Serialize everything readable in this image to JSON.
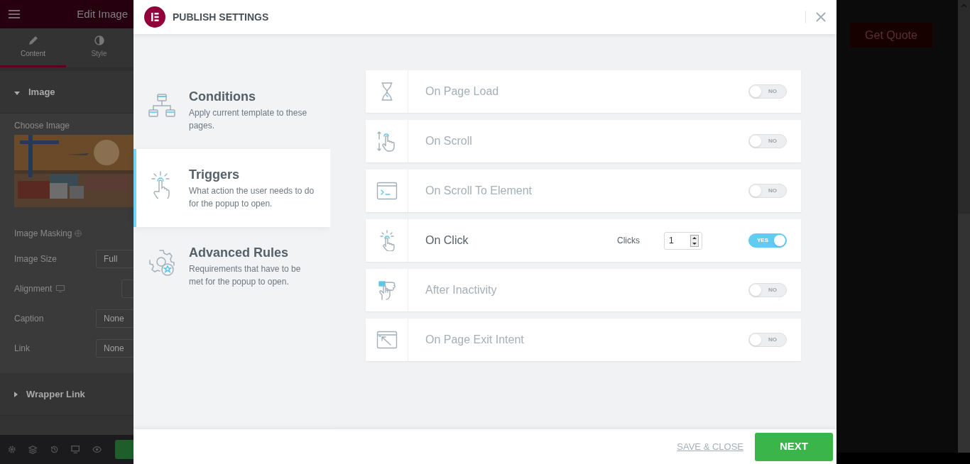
{
  "editor": {
    "title": "Edit Image",
    "tabs": [
      {
        "label": "Content",
        "selected": true
      },
      {
        "label": "Style",
        "selected": false
      }
    ],
    "sections": [
      {
        "title": "Image",
        "expanded": true
      },
      {
        "title": "Wrapper Link",
        "expanded": false
      }
    ],
    "choose_image": {
      "label": "Choose Image"
    },
    "image_masking": {
      "label": "Image Masking"
    },
    "fields": [
      {
        "kind": "select",
        "label": "Image Size",
        "value": "Full"
      },
      {
        "kind": "responsive",
        "label": "Alignment"
      },
      {
        "kind": "select",
        "label": "Caption",
        "value": "None"
      },
      {
        "kind": "select",
        "label": "Link",
        "value": "None"
      }
    ]
  },
  "canvas": {
    "button": "Get Quote"
  },
  "modal": {
    "title": "PUBLISH SETTINGS",
    "nav": [
      {
        "title": "Conditions",
        "description": "Apply current template to these pages.",
        "selected": false
      },
      {
        "title": "Triggers",
        "description": "What action the user needs to do for the popup to open.",
        "selected": true
      },
      {
        "title": "Advanced Rules",
        "description": "Requirements that have to be met for the popup to open.",
        "selected": false
      }
    ],
    "triggers": [
      {
        "label": "On Page Load",
        "on": false,
        "toggle": "NO"
      },
      {
        "label": "On Scroll",
        "on": false,
        "toggle": "NO"
      },
      {
        "label": "On Scroll To Element",
        "on": false,
        "toggle": "NO"
      },
      {
        "label": "On Click",
        "on": true,
        "toggle": "YES",
        "setting": {
          "label": "Clicks",
          "value": "1"
        }
      },
      {
        "label": "After Inactivity",
        "on": false,
        "toggle": "NO"
      },
      {
        "label": "On Page Exit Intent",
        "on": false,
        "toggle": "NO"
      }
    ],
    "footer": {
      "secondary": "SAVE & CLOSE",
      "primary": "NEXT"
    }
  }
}
